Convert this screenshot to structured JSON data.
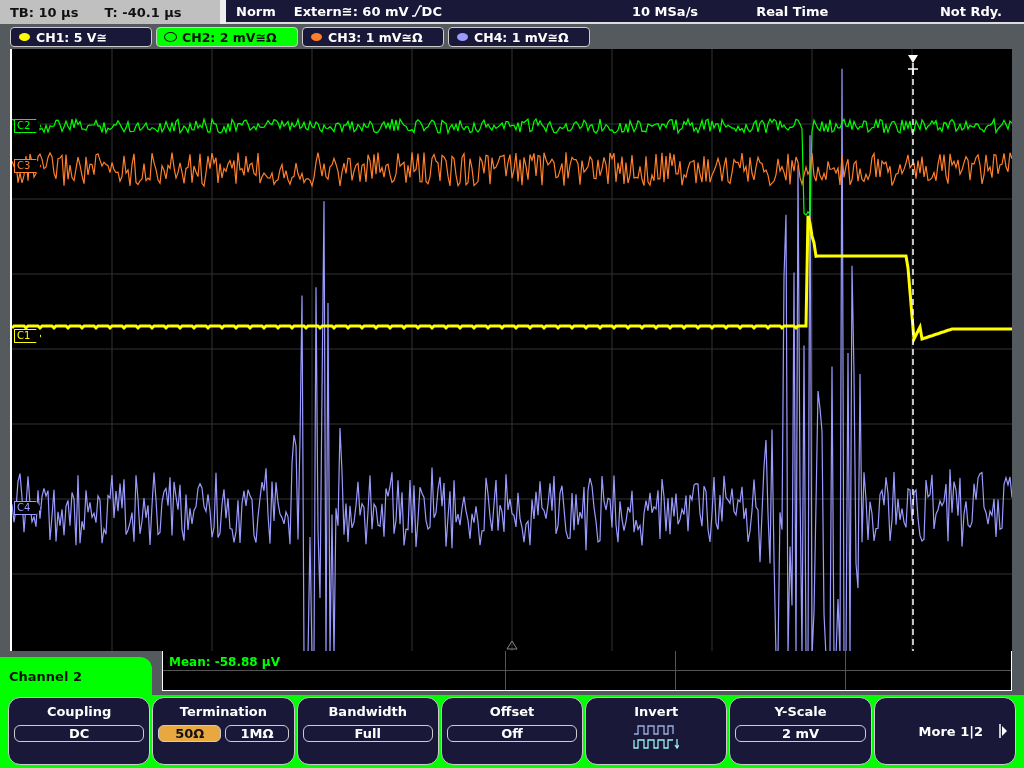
{
  "status_bar": {
    "timebase": "TB: 10 µs",
    "trigger_time": "T: -40.1 µs",
    "trigger_mode": "Norm",
    "trigger_source": "Extern≅: 60 mV",
    "trigger_coupling": "DC",
    "sample_rate": "10 MSa/s",
    "acquisition": "Real Time",
    "state": "Not Rdy."
  },
  "channels": [
    {
      "label": "CH1: 5 V≅",
      "color": "#ffff00",
      "selected": false
    },
    {
      "label": "CH2: 2 mV≅Ω",
      "color": "#00ff00",
      "selected": true
    },
    {
      "label": "CH3: 1 mV≅Ω",
      "color": "#ff7f2a",
      "selected": false
    },
    {
      "label": "CH4: 1 mV≅Ω",
      "color": "#9a9aff",
      "selected": false
    }
  ],
  "markers": [
    {
      "label": "C2",
      "color": "#00ff00"
    },
    {
      "label": "C3",
      "color": "#ff7f2a"
    },
    {
      "label": "C1",
      "color": "#ffff00"
    },
    {
      "label": "C4",
      "color": "#9a9aff"
    }
  ],
  "measurement": "Mean: -58.88 µV",
  "menu": {
    "title": "Channel 2",
    "softkeys": [
      {
        "kind": "value",
        "title": "Coupling",
        "value": "DC"
      },
      {
        "kind": "toggle",
        "title": "Termination",
        "options": [
          {
            "label": "50Ω",
            "selected": true
          },
          {
            "label": "1MΩ",
            "selected": false
          }
        ]
      },
      {
        "kind": "value",
        "title": "Bandwidth",
        "value": "Full"
      },
      {
        "kind": "value",
        "title": "Offset",
        "value": "Off"
      },
      {
        "kind": "icon",
        "title": "Invert"
      },
      {
        "kind": "value",
        "title": "Y-Scale",
        "value": "2 mV"
      },
      {
        "kind": "next",
        "title": "More 1|2"
      }
    ]
  }
}
